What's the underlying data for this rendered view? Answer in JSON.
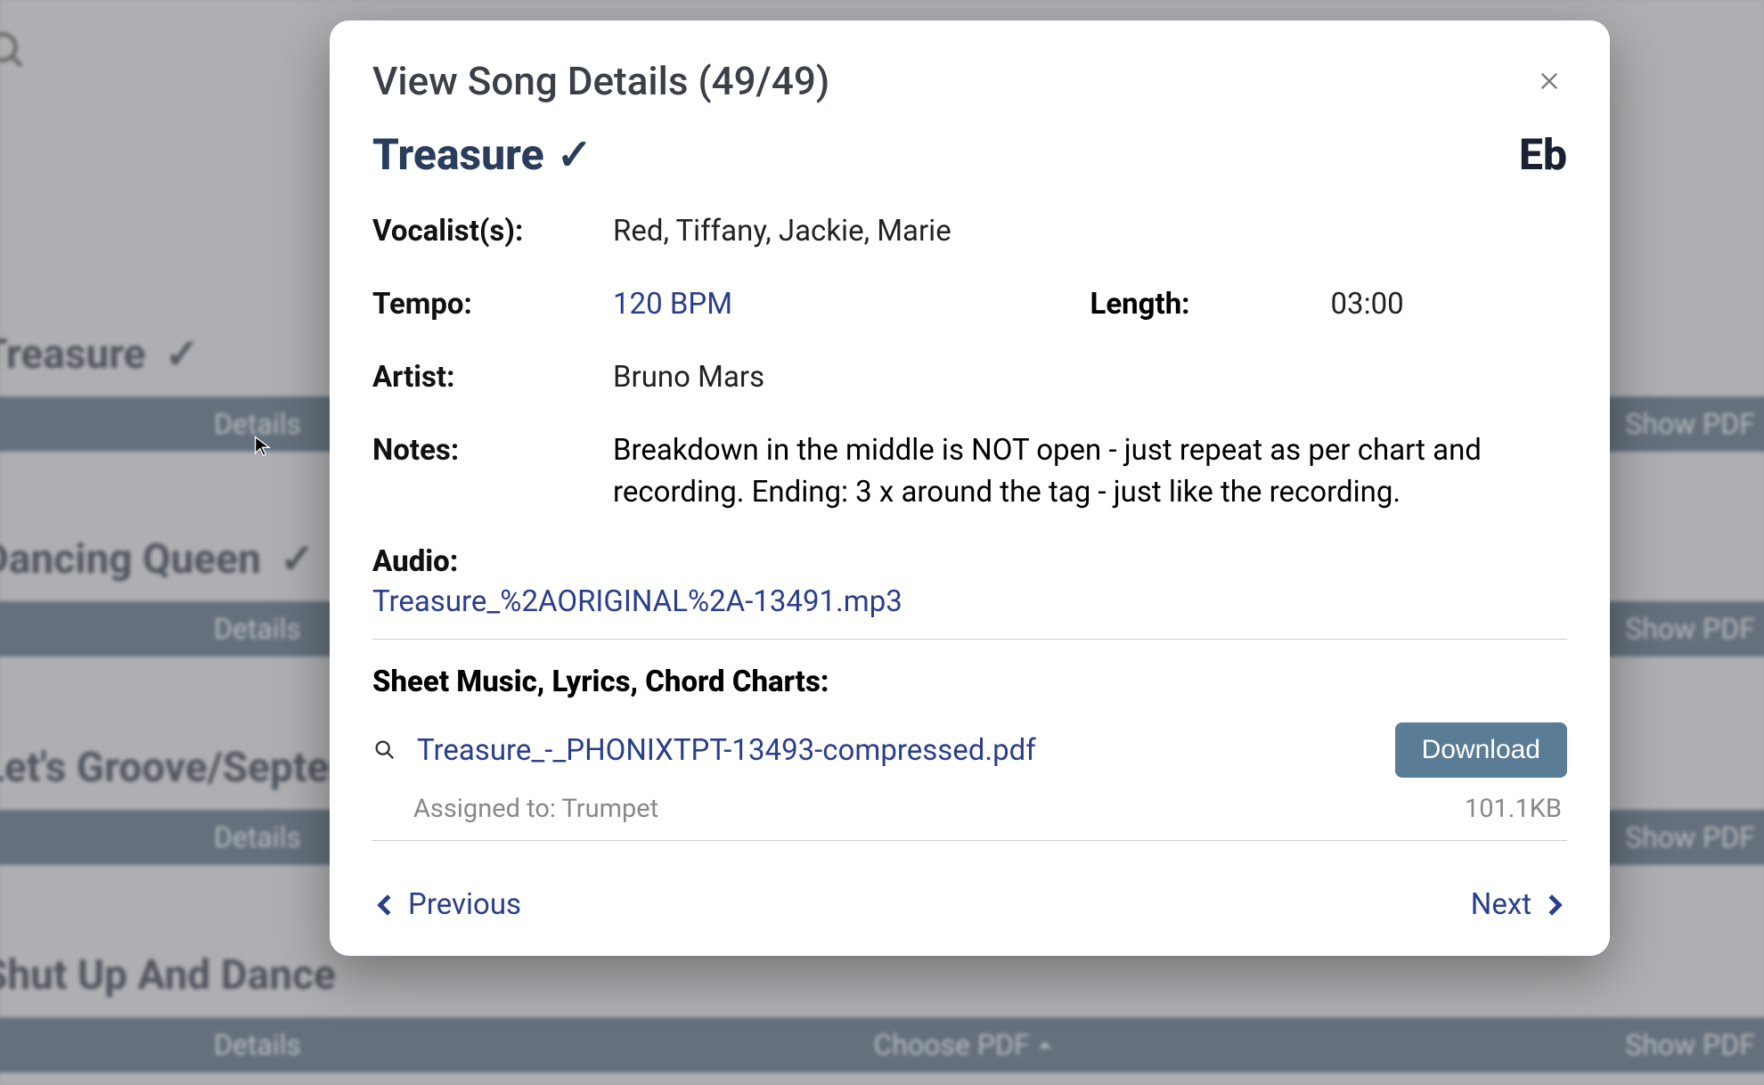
{
  "background": {
    "rows": [
      {
        "title": "Treasure",
        "check": true,
        "details": "Details",
        "pdf": "Show PDF"
      },
      {
        "title": "Dancing Queen",
        "check": true,
        "details": "Details",
        "pdf": "Show PDF"
      },
      {
        "title": "Let's Groove/September",
        "check": false,
        "details": "Details",
        "pdf": "Show PDF"
      },
      {
        "title": "Shut Up And Dance",
        "check": false,
        "details": "Details",
        "choose": "Choose PDF",
        "pdf": "Show PDF"
      }
    ]
  },
  "modal": {
    "title": "View Song Details (49/49)",
    "song_title": "Treasure",
    "song_key": "Eb",
    "vocalists_label": "Vocalist(s):",
    "vocalists": "Red, Tiffany, Jackie, Marie",
    "tempo_label": "Tempo:",
    "tempo": "120 BPM",
    "length_label": "Length:",
    "length": "03:00",
    "artist_label": "Artist:",
    "artist": "Bruno Mars",
    "notes_label": "Notes:",
    "notes": "Breakdown in the middle is NOT open - just repeat as per chart and recording. Ending: 3 x around the tag - just like the recording.",
    "audio_label": "Audio:",
    "audio_file": "Treasure_%2AORIGINAL%2A-13491.mp3",
    "sheet_label": "Sheet Music, Lyrics, Chord Charts:",
    "file_name": "Treasure_-_PHONIXTPT-13493-compressed.pdf",
    "download": "Download",
    "assigned": "Assigned to: Trumpet",
    "file_size": "101.1KB",
    "previous": "Previous",
    "next": "Next"
  }
}
